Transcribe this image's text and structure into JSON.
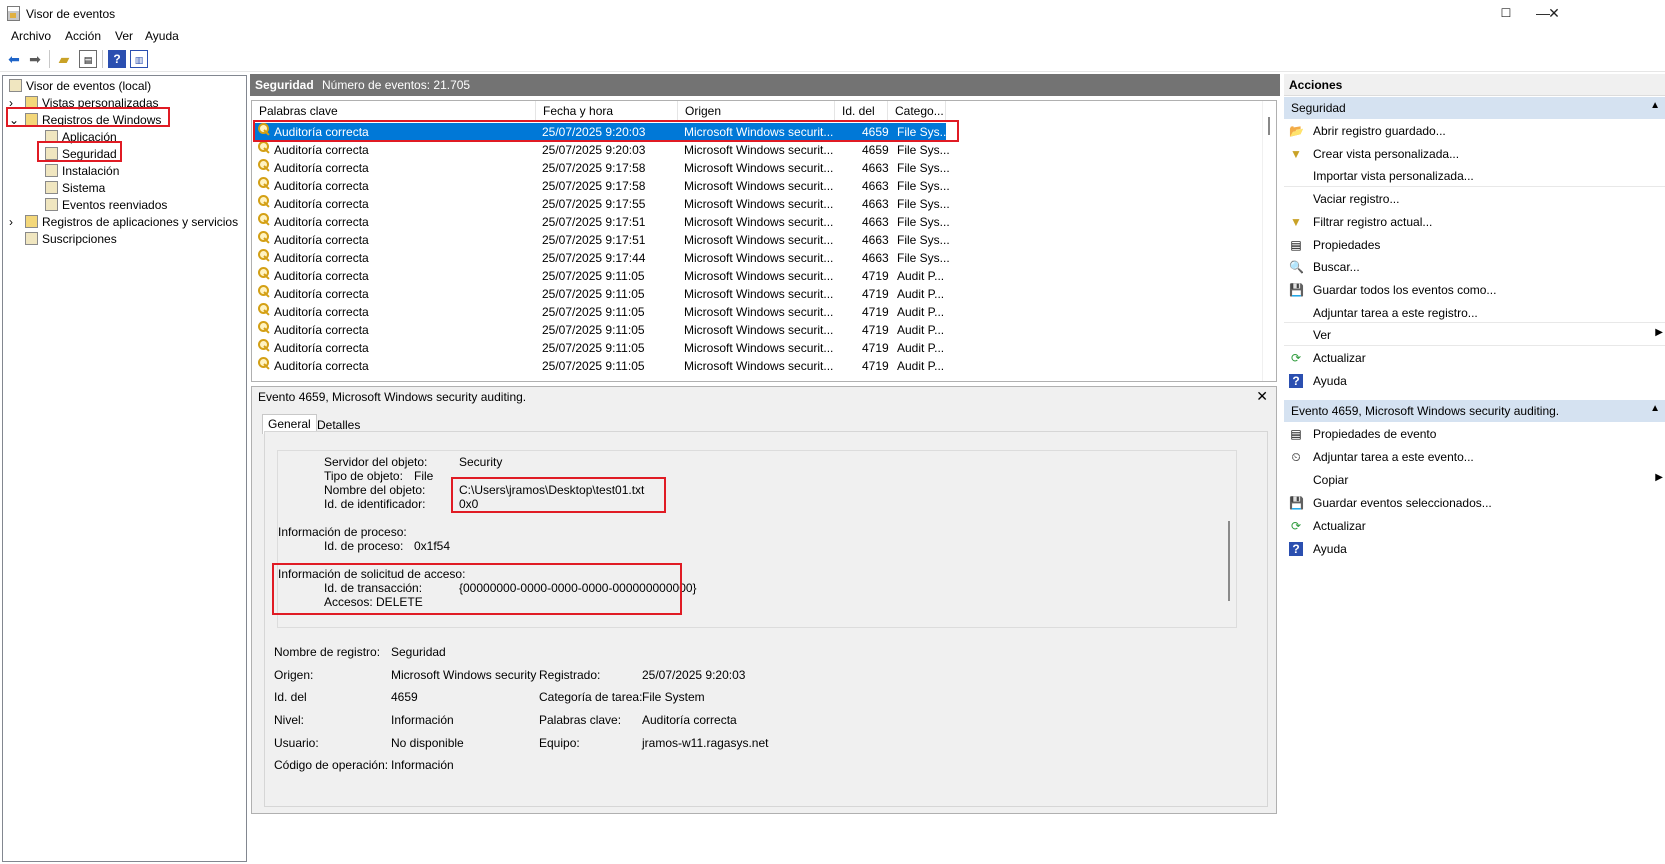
{
  "window": {
    "title": "Visor de eventos",
    "minimize": "—",
    "maximize": "☐",
    "close": "✕"
  },
  "menu": [
    "Archivo",
    "Acción",
    "Ver",
    "Ayuda"
  ],
  "tree": {
    "root": "Visor de eventos (local)",
    "custom_views": "Vistas personalizadas",
    "windows_logs": "Registros de Windows",
    "application": "Aplicación",
    "security": "Seguridad",
    "setup": "Instalación",
    "system": "Sistema",
    "forwarded": "Eventos reenviados",
    "apps_services": "Registros de aplicaciones y servicios",
    "subscriptions": "Suscripciones"
  },
  "center": {
    "log_name": "Seguridad",
    "event_count": "Número de eventos: 21.705"
  },
  "columns": [
    "Palabras clave",
    "Fecha y hora",
    "Origen",
    "Id. del ...",
    "Catego..."
  ],
  "events": [
    {
      "keyword": "Auditoría correcta",
      "datetime": "25/07/2025 9:20:03",
      "source": "Microsoft Windows securit...",
      "id": "4659",
      "category": "File Sys..."
    },
    {
      "keyword": "Auditoría correcta",
      "datetime": "25/07/2025 9:20:03",
      "source": "Microsoft Windows securit...",
      "id": "4659",
      "category": "File Sys..."
    },
    {
      "keyword": "Auditoría correcta",
      "datetime": "25/07/2025 9:17:58",
      "source": "Microsoft Windows securit...",
      "id": "4663",
      "category": "File Sys..."
    },
    {
      "keyword": "Auditoría correcta",
      "datetime": "25/07/2025 9:17:58",
      "source": "Microsoft Windows securit...",
      "id": "4663",
      "category": "File Sys..."
    },
    {
      "keyword": "Auditoría correcta",
      "datetime": "25/07/2025 9:17:55",
      "source": "Microsoft Windows securit...",
      "id": "4663",
      "category": "File Sys..."
    },
    {
      "keyword": "Auditoría correcta",
      "datetime": "25/07/2025 9:17:51",
      "source": "Microsoft Windows securit...",
      "id": "4663",
      "category": "File Sys..."
    },
    {
      "keyword": "Auditoría correcta",
      "datetime": "25/07/2025 9:17:51",
      "source": "Microsoft Windows securit...",
      "id": "4663",
      "category": "File Sys..."
    },
    {
      "keyword": "Auditoría correcta",
      "datetime": "25/07/2025 9:17:44",
      "source": "Microsoft Windows securit...",
      "id": "4663",
      "category": "File Sys..."
    },
    {
      "keyword": "Auditoría correcta",
      "datetime": "25/07/2025 9:11:05",
      "source": "Microsoft Windows securit...",
      "id": "4719",
      "category": "Audit P..."
    },
    {
      "keyword": "Auditoría correcta",
      "datetime": "25/07/2025 9:11:05",
      "source": "Microsoft Windows securit...",
      "id": "4719",
      "category": "Audit P..."
    },
    {
      "keyword": "Auditoría correcta",
      "datetime": "25/07/2025 9:11:05",
      "source": "Microsoft Windows securit...",
      "id": "4719",
      "category": "Audit P..."
    },
    {
      "keyword": "Auditoría correcta",
      "datetime": "25/07/2025 9:11:05",
      "source": "Microsoft Windows securit...",
      "id": "4719",
      "category": "Audit P..."
    },
    {
      "keyword": "Auditoría correcta",
      "datetime": "25/07/2025 9:11:05",
      "source": "Microsoft Windows securit...",
      "id": "4719",
      "category": "Audit P..."
    },
    {
      "keyword": "Auditoría correcta",
      "datetime": "25/07/2025 9:11:05",
      "source": "Microsoft Windows securit...",
      "id": "4719",
      "category": "Audit P..."
    }
  ],
  "detail": {
    "title": "Evento 4659, Microsoft Windows security auditing.",
    "close": "✕",
    "tabs": [
      "General",
      "Detalles"
    ],
    "description": {
      "object_server_label": "Servidor del objeto:",
      "object_server_value": "Security",
      "object_type_label": "Tipo de objeto:",
      "object_type_value": "File",
      "object_name_label": "Nombre del objeto:",
      "object_name_value": "C:\\Users\\jramos\\Desktop\\test01.txt",
      "handle_label": "Id. de identificador:",
      "handle_value": "0x0",
      "process_info": "Información de proceso:",
      "process_id_label": "Id. de proceso:",
      "process_id_value": "0x1f54",
      "access_request": "Información de solicitud de acceso:",
      "transaction_label": "Id. de transacción:",
      "transaction_value": "{00000000-0000-0000-0000-000000000000}",
      "accesses": "Accesos: DELETE"
    },
    "fields": {
      "log_name_label": "Nombre de registro:",
      "log_name": "Seguridad",
      "source_label": "Origen:",
      "source": "Microsoft Windows security",
      "logged_label": "Registrado:",
      "logged": "25/07/2025 9:20:03",
      "event_id_label": "Id. del",
      "event_id": "4659",
      "task_label": "Categoría de tarea:",
      "task": "File System",
      "level_label": "Nivel:",
      "level": "Información",
      "keywords_label": "Palabras clave:",
      "keywords": "Auditoría correcta",
      "user_label": "Usuario:",
      "user": "No disponible",
      "computer_label": "Equipo:",
      "computer": "jramos-w11.ragasys.net",
      "opcode_label": "Código de operación:",
      "opcode": "Información"
    }
  },
  "actions": {
    "header": "Acciones",
    "section1": "Seguridad",
    "items1": [
      "Abrir registro guardado...",
      "Crear vista personalizada...",
      "Importar vista personalizada...",
      "Vaciar registro...",
      "Filtrar registro actual...",
      "Propiedades",
      "Buscar...",
      "Guardar todos los eventos como...",
      "Adjuntar tarea a este registro...",
      "Ver",
      "Actualizar",
      "Ayuda"
    ],
    "section2": "Evento 4659, Microsoft Windows security auditing.",
    "items2": [
      "Propiedades de evento",
      "Adjuntar tarea a este evento...",
      "Copiar",
      "Guardar eventos seleccionados...",
      "Actualizar",
      "Ayuda"
    ]
  },
  "colors": {
    "selection": "#0078d7",
    "center_header": "#737373",
    "action_section": "#d5e2f1",
    "annotation": "#e01b24"
  }
}
